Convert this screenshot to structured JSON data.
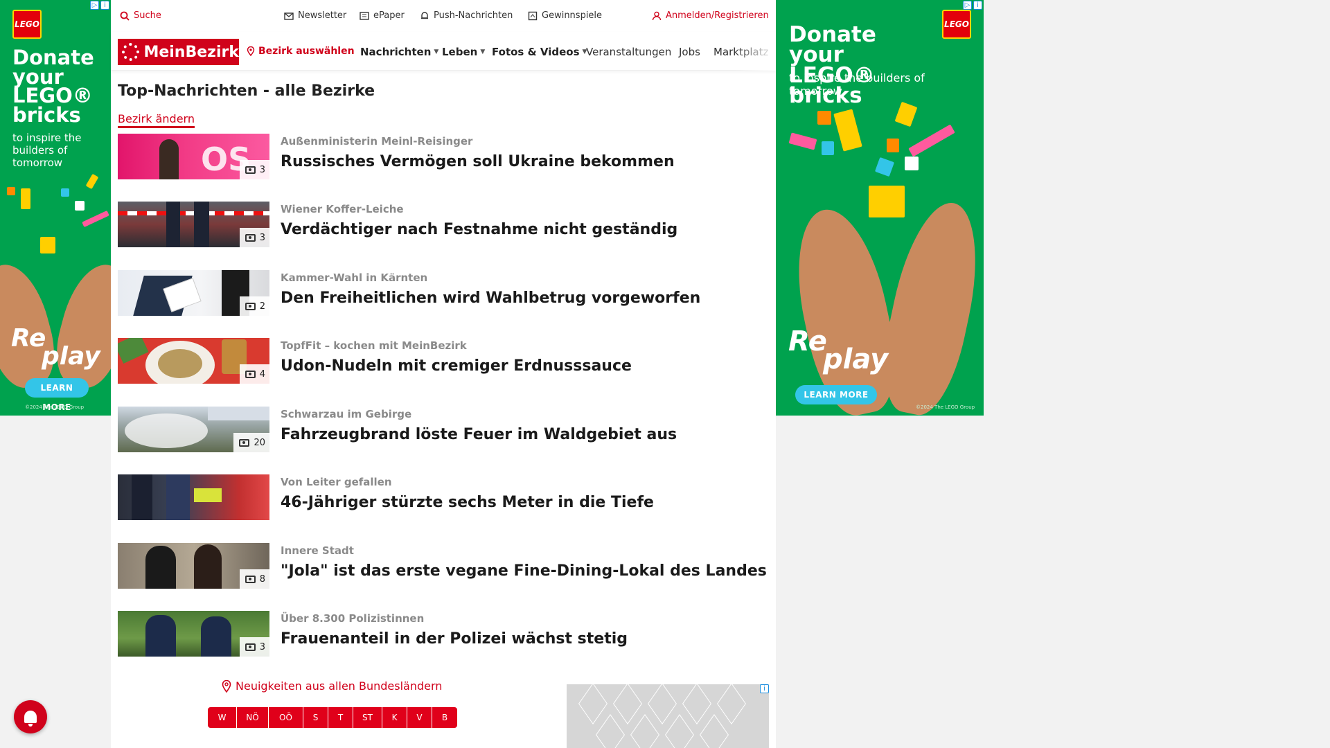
{
  "ads": {
    "left": {
      "logo": "LEGO",
      "headline": "Donate your LEGO® bricks",
      "subline": "to inspire the builders of tomorrow",
      "replay_1": "Re",
      "replay_2": "play",
      "button": "LEARN MORE",
      "copyright": "©2024 The LEGO Group"
    },
    "right": {
      "logo": "LEGO",
      "headline": "Donate your LEGO® bricks",
      "subline": "to inspire the builders of tomorrow",
      "replay_1": "Re",
      "replay_2": "play",
      "button": "LEARN MORE",
      "copyright": "©2024 The LEGO Group"
    },
    "ad_choice": "▷",
    "info": "i"
  },
  "topbar": {
    "search": "Suche",
    "newsletter": "Newsletter",
    "epaper": "ePaper",
    "push": "Push-Nachrichten",
    "contests": "Gewinnspiele",
    "login": "Anmelden/Registrieren"
  },
  "nav": {
    "brand": "MeinBezirk",
    "district": "Bezirk auswählen",
    "news": "Nachrichten",
    "life": "Leben",
    "media": "Fotos & Videos",
    "events": "Veranstaltungen",
    "jobs": "Jobs",
    "market": "Marktplatz"
  },
  "main": {
    "title": "Top-Nachrichten - alle Bezirke",
    "change_district": "Bezirk ändern",
    "articles": [
      {
        "kicker": "Außenministerin Meinl-Reisinger",
        "headline": "Russisches Vermögen soll Ukraine bekommen",
        "photos": "3"
      },
      {
        "kicker": "Wiener Koffer-Leiche",
        "headline": "Verdächtiger nach Festnahme nicht geständig",
        "photos": "3"
      },
      {
        "kicker": "Kammer-Wahl in Kärnten",
        "headline": "Den Freiheitlichen wird Wahlbetrug vorgeworfen",
        "photos": "2"
      },
      {
        "kicker": "TopfFit – kochen mit MeinBezirk",
        "headline": "Udon-Nudeln mit cremiger Erdnusssauce",
        "photos": "4"
      },
      {
        "kicker": "Schwarzau im Gebirge",
        "headline": "Fahrzeugbrand löste Feuer im Waldgebiet aus",
        "photos": "20"
      },
      {
        "kicker": "Von Leiter gefallen",
        "headline": "46-Jähriger stürzte sechs Meter in die Tiefe",
        "photos": ""
      },
      {
        "kicker": "Innere Stadt",
        "headline": "\"Jola\" ist das erste vegane Fine-Dining-Lokal des Landes",
        "photos": "8"
      },
      {
        "kicker": "Über 8.300 Polizistinnen",
        "headline": "Frauenanteil in der Polizei wächst stetig",
        "photos": "3"
      }
    ],
    "states_label": "Neuigkeiten aus allen Bundesländern",
    "states": [
      "W",
      "NÖ",
      "OÖ",
      "S",
      "T",
      "ST",
      "K",
      "V",
      "B"
    ]
  }
}
